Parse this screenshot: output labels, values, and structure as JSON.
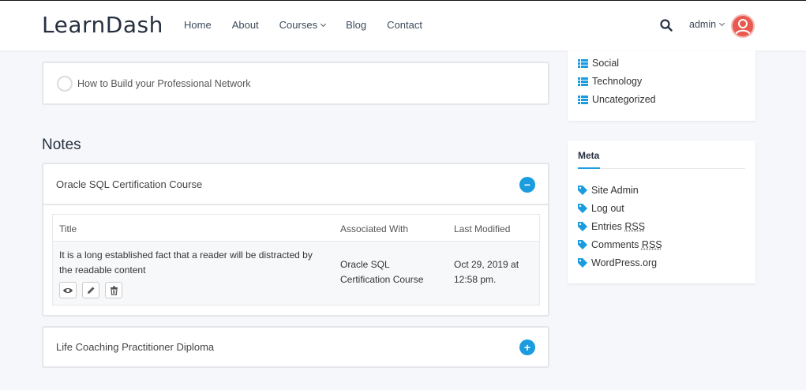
{
  "brand": {
    "logo": "LearnDash"
  },
  "nav": {
    "items": [
      {
        "label": "Home"
      },
      {
        "label": "About"
      },
      {
        "label": "Courses"
      },
      {
        "label": "Blog"
      },
      {
        "label": "Contact"
      }
    ],
    "user_label": "admin"
  },
  "lesson": {
    "title": "How to Build your Professional Network"
  },
  "notes": {
    "heading": "Notes",
    "accordions": [
      {
        "title": "Oracle SQL Certification Course",
        "toggle": "−",
        "table": {
          "headers": [
            "Title",
            "Associated With",
            "Last Modified"
          ],
          "rows": [
            {
              "title_line1": "It is a long established fact that a reader will be distracted by",
              "title_line2": "the readable content",
              "assoc_line1": "Oracle SQL",
              "assoc_line2": "Certification Course",
              "modified_line1": "Oct 29, 2019 at",
              "modified_line2": "12:58 pm."
            }
          ]
        }
      },
      {
        "title": "Life Coaching Practitioner Diploma",
        "toggle": "+"
      }
    ]
  },
  "sidebar": {
    "categories": [
      {
        "label": "Social"
      },
      {
        "label": "Technology"
      },
      {
        "label": "Uncategorized"
      }
    ],
    "meta": {
      "title": "Meta",
      "links": [
        {
          "label": "Site Admin"
        },
        {
          "label": "Log out"
        },
        {
          "label": "Entries",
          "abbr": "RSS"
        },
        {
          "label": "Comments",
          "abbr": "RSS"
        },
        {
          "label": "WordPress.org"
        }
      ]
    }
  },
  "colors": {
    "accent": "#1b9cde",
    "avatar": "#e85a4f"
  }
}
